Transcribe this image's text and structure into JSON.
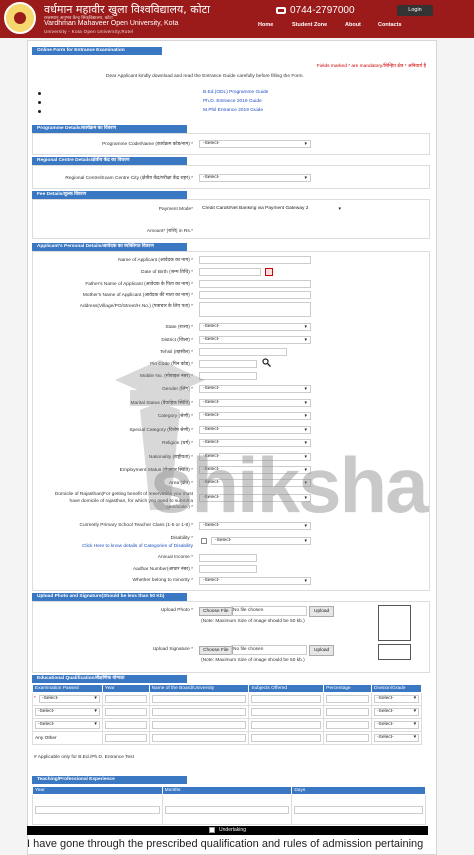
{
  "header": {
    "univ_hindi": "वर्धमान महावीर खुला विश्वविद्यालय, कोटा",
    "univ_hindi_sub": "राजस्थान      अनुभव केन्द्र सिकविद्यालय, कोटा",
    "univ_eng": "Vardhman Mahaveer Open University, Kota",
    "univ_eng_sub": "University - Kota Open University,Rotel",
    "phone": "0744-2797000",
    "login": "Login",
    "nav": [
      "Home",
      "Student Zone",
      "About",
      "Contacts"
    ]
  },
  "form": {
    "title": "Online Form for Entrance Examination",
    "mandatory": "Fields marked * are mandatory/चिन्हित क्षेत्र * अनिवार्य है",
    "intro": "Dear Applicant kindly download and read the Entrance Guide carefully before filling the Form.",
    "guides": [
      "B.Ed.(ODL) Programme Guide",
      "Ph.D. Entrance 2019 Guide",
      "M.Phil Entrance 2019 Guide"
    ],
    "programme": {
      "header": "Programme Details/कार्यक्रम का विवरण",
      "label": "Programme Code/Name (कार्यक्रम कोड/नाम) *",
      "value": "-Select-"
    },
    "regional": {
      "header": "Regional Centre Details/क्षेत्रीय केंद्र का विवरण",
      "label": "Regional Centre/Exam Centre City (क्षेत्रीय केंद्र/परीक्षा केंद्र शहर) *",
      "value": "-Select-"
    },
    "fee": {
      "header": "Fee Details/शुल्क विवरण",
      "payment_label": "Payment Mode*",
      "payment_value": "Credit Cards/Net Banking via Payment Gateway 2",
      "amount_label": "Amount* (राशि) in Rs.*"
    },
    "personal": {
      "header": "Applicant's Personal Details/आवेदक का व्यक्तिगत विवरण",
      "fields": [
        {
          "label": "Name of Applicant (आवेदक का नाम) *",
          "type": "input"
        },
        {
          "label": "Date of Birth (जन्म तिथि) *",
          "type": "date"
        },
        {
          "label": "Father's Name of Applicant (आवेदक के पिता का नाम) *",
          "type": "input"
        },
        {
          "label": "Mother's Name of Applicant (आवेदक की माता का नाम) *",
          "type": "input"
        },
        {
          "label": "Address(Village/PO/Street/H.No.) (पत्राचार के लिए पता) *",
          "type": "textarea"
        },
        {
          "label": "State (राज्य) *",
          "type": "select",
          "value": "-Select-"
        },
        {
          "label": "District (जिला) *",
          "type": "select",
          "value": "-Select-"
        },
        {
          "label": "Tehsil (तहसील) *",
          "type": "input"
        },
        {
          "label": "Pin Code (पिन कोड) *",
          "type": "pin"
        },
        {
          "label": "Mobile No. (मोबाइल नंबर) *",
          "type": "input"
        },
        {
          "label": "Gender (लिंग) *",
          "type": "select",
          "value": "-Select-"
        },
        {
          "label": "Marital Status (वैवाहिक स्थिति) *",
          "type": "select",
          "value": "-Select-"
        },
        {
          "label": "Category (श्रेणी) *",
          "type": "select",
          "value": "-Select-"
        },
        {
          "label": "Special Category (विशेष श्रेणी) *",
          "type": "select",
          "value": "-Select-"
        },
        {
          "label": "Religion (धर्म) *",
          "type": "select",
          "value": "-Select-"
        },
        {
          "label": "Nationality (राष्ट्रीयता) *",
          "type": "select",
          "value": "-Select-"
        },
        {
          "label": "Employment Status (रोजगार स्थिति) *",
          "type": "select",
          "value": "-Select-"
        },
        {
          "label": "Area (क्षेत्र) *",
          "type": "select",
          "value": "-Select-"
        }
      ],
      "domicile_label": "Domicile of Rajasthan(For getting benefit of reservation you must have domicile of rajasthan, for which you need to submit a certificate.) *",
      "domicile_value": "-Select-",
      "school_label": "Currently Primary School Teacher Class (1-5 or 1-8) *",
      "school_value": "-Select-",
      "disability_label": "Disability *",
      "disability_link": "Click Here to know details of Categories of Disability",
      "disability_value": "-Select-",
      "income_label": "Annual Income *",
      "aadhar_label": "Aadhar Number(आधार नंबर) *",
      "minority_label": "Whether belong to minority *",
      "minority_value": "-Select-"
    },
    "upload": {
      "header": "Upload Photo and Signature(Should be less than 50 Kb)",
      "photo_label": "Upload Photo *",
      "signature_label": "Upload Signature *",
      "choose": "Choose File",
      "no_file": "No file chosen",
      "upload_btn": "Upload",
      "note": "(Note: Maximum Size of image should be 50 kb.)"
    },
    "education": {
      "header": "Educational Qualification/शैक्षणिक योग्यता",
      "columns": [
        "Examination Passed",
        "Year",
        "Name of the Board/University",
        "Subjects Offered",
        "Percentage",
        "Division/Grade"
      ],
      "exam_values": [
        "-Select-",
        "-Select-",
        "-Select-",
        "Any Other"
      ],
      "grade_value": "-Select-",
      "note": "# Applicable only for B.Ed./Ph.D. Entrance Test"
    },
    "experience": {
      "header": "Teaching/Professional Experience",
      "columns": [
        "Year",
        "Months",
        "Days"
      ]
    },
    "undertaking": "Undertaking",
    "declaration": "I have gone through the prescribed qualification and rules of admission pertaining"
  },
  "watermark": "shiksha"
}
